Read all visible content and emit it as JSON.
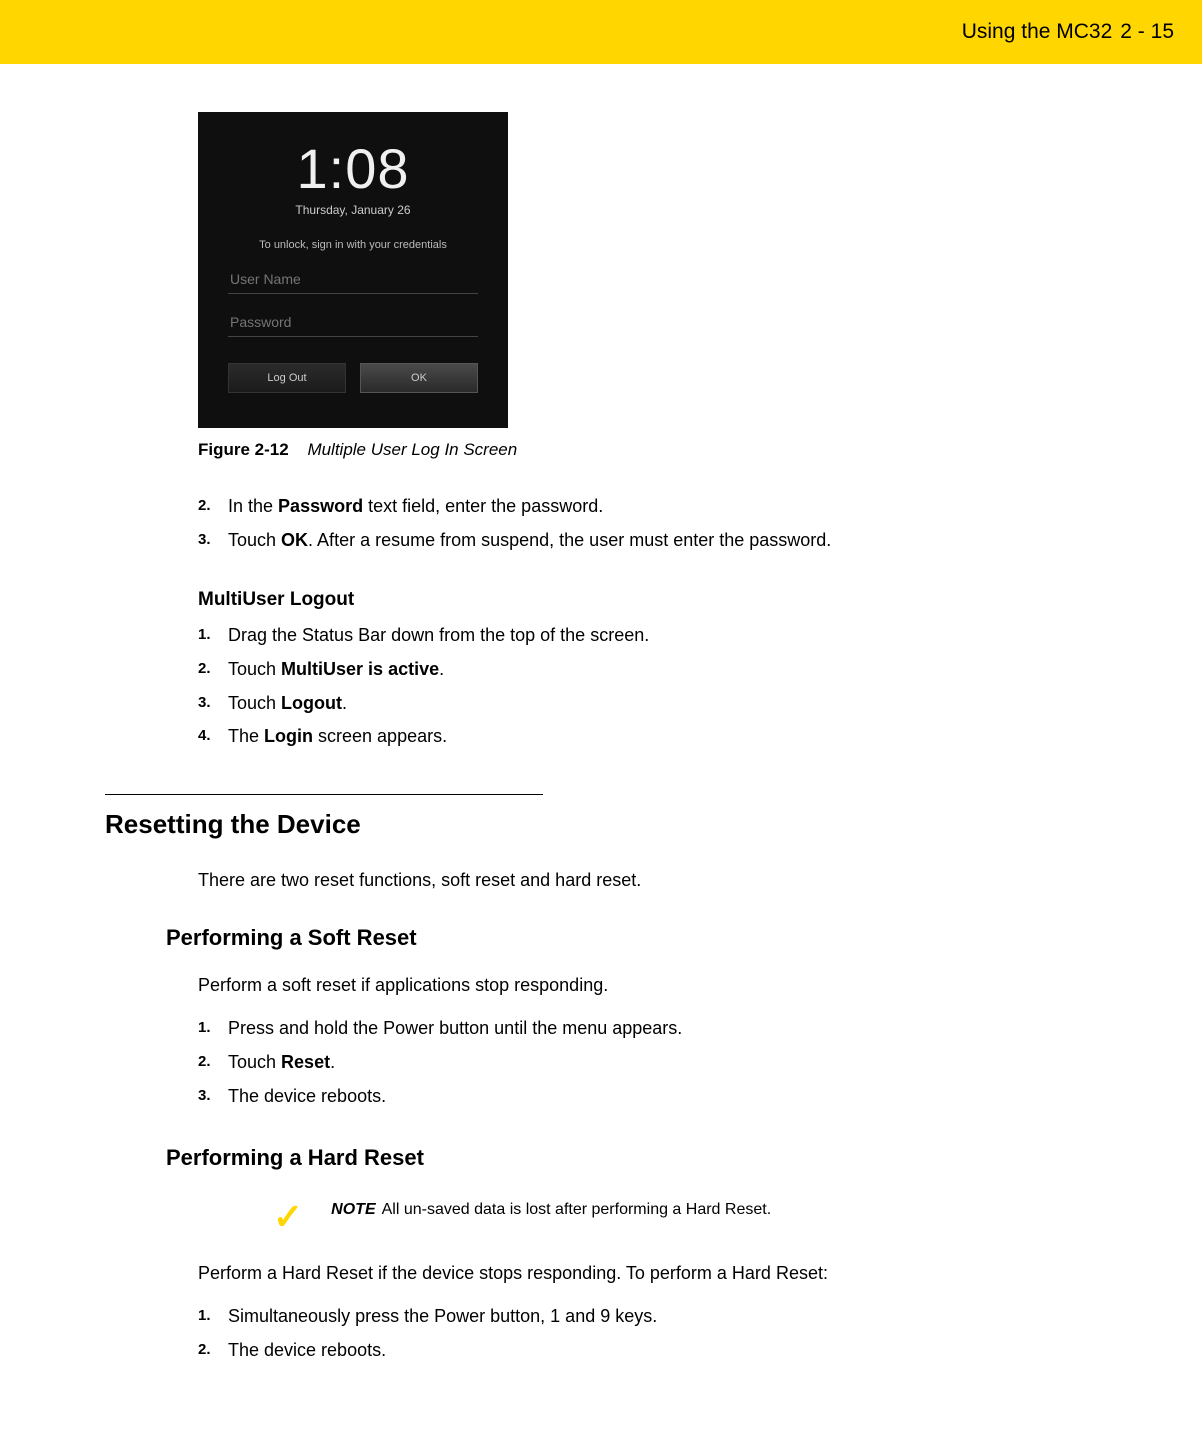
{
  "header": {
    "chapter": "Using the MC32",
    "page": "2 - 15"
  },
  "lockscreen": {
    "clock": "1:08",
    "date": "Thursday, January 26",
    "hint": "To unlock, sign in with your credentials",
    "username_placeholder": "User Name",
    "password_placeholder": "Password",
    "logout_label": "Log Out",
    "ok_label": "OK"
  },
  "figure": {
    "number": "Figure 2-12",
    "title": "Multiple User Log In Screen"
  },
  "login_steps": [
    {
      "num": "2.",
      "prefix": "In the ",
      "bold1": "Password",
      "mid": " text field, enter the password.",
      "bold2": "",
      "suffix": ""
    },
    {
      "num": "3.",
      "prefix": "Touch ",
      "bold1": "OK",
      "mid": ". After a resume from suspend, the user must enter the password.",
      "bold2": "",
      "suffix": ""
    }
  ],
  "logout_heading": "MultiUser Logout",
  "logout_steps": [
    {
      "num": "1.",
      "prefix": "Drag the Status Bar down from the top of the screen.",
      "bold1": "",
      "mid": "",
      "bold2": "",
      "suffix": ""
    },
    {
      "num": "2.",
      "prefix": "Touch ",
      "bold1": "MultiUser is active",
      "mid": ".",
      "bold2": "",
      "suffix": ""
    },
    {
      "num": "3.",
      "prefix": "Touch ",
      "bold1": "Logout",
      "mid": ".",
      "bold2": "",
      "suffix": ""
    },
    {
      "num": "4.",
      "prefix": "The ",
      "bold1": "Login",
      "mid": " screen appears.",
      "bold2": "",
      "suffix": ""
    }
  ],
  "reset_section_title": "Resetting the Device",
  "reset_intro": "There are two reset functions, soft reset and hard reset.",
  "soft_reset_heading": "Performing a Soft Reset",
  "soft_reset_intro": "Perform a soft reset if applications stop responding.",
  "soft_reset_steps": [
    {
      "num": "1.",
      "prefix": "Press and hold the Power button until the menu appears.",
      "bold1": "",
      "mid": "",
      "bold2": "",
      "suffix": ""
    },
    {
      "num": "2.",
      "prefix": "Touch ",
      "bold1": "Reset",
      "mid": ".",
      "bold2": "",
      "suffix": ""
    },
    {
      "num": "3.",
      "prefix": "The device reboots.",
      "bold1": "",
      "mid": "",
      "bold2": "",
      "suffix": ""
    }
  ],
  "hard_reset_heading": "Performing a Hard Reset",
  "note": {
    "label": "NOTE",
    "text": "All un-saved data is lost after performing a Hard Reset."
  },
  "hard_reset_intro": "Perform a Hard Reset if the device stops responding. To perform a Hard Reset:",
  "hard_reset_steps": [
    {
      "num": "1.",
      "prefix": "Simultaneously press the Power button, 1 and 9 keys.",
      "bold1": "",
      "mid": "",
      "bold2": "",
      "suffix": ""
    },
    {
      "num": "2.",
      "prefix": "The device reboots.",
      "bold1": "",
      "mid": "",
      "bold2": "",
      "suffix": ""
    }
  ]
}
